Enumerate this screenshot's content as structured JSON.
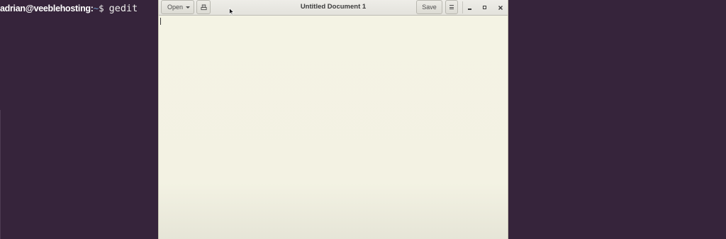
{
  "terminal": {
    "user_host": "adrian@veeblehosting:",
    "path": "~",
    "prompt_symbol": "$",
    "command": "gedit"
  },
  "gedit": {
    "title": "Untitled Document 1",
    "open_label": "Open",
    "save_label": "Save",
    "text_content": ""
  },
  "icons": {
    "open_dropdown": "chevron-down-icon",
    "new_document": "new-document-icon",
    "menu": "hamburger-menu-icon",
    "minimize": "minimize-icon",
    "maximize": "maximize-icon",
    "close": "close-icon",
    "mouse_pointer": "mouse-pointer-icon"
  },
  "colors": {
    "desktop_bg": "#36243b",
    "editor_bg": "#f4f3e4",
    "path_blue": "#729fcf"
  }
}
